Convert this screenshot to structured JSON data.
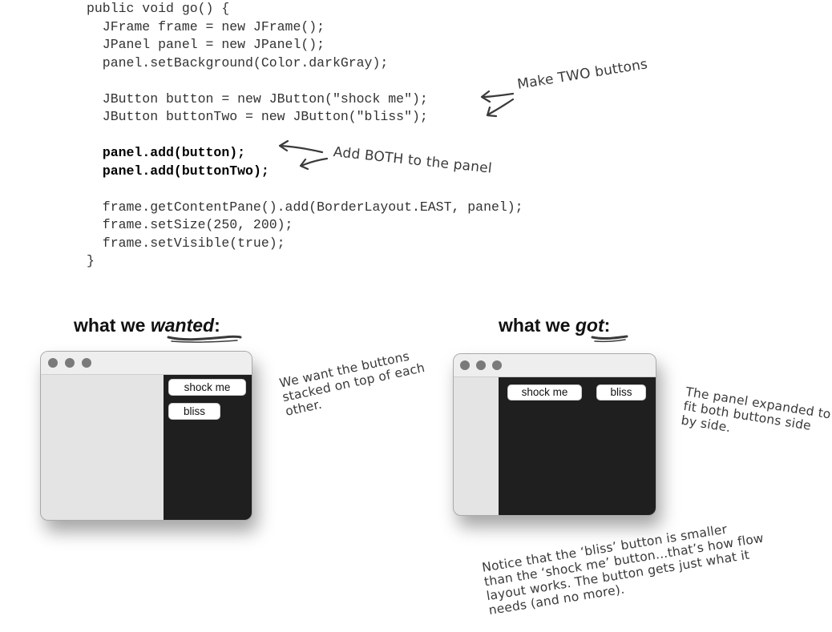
{
  "code": {
    "lines": [
      "public void go() {",
      "  JFrame frame = new JFrame();",
      "  JPanel panel = new JPanel();",
      "  panel.setBackground(Color.darkGray);",
      "",
      "  JButton button = new JButton(\"shock me\");",
      "  JButton buttonTwo = new JButton(\"bliss\");",
      "",
      "  ",
      "  ",
      "",
      "  frame.getContentPane().add(BorderLayout.EAST, panel);",
      "  frame.setSize(250, 200);",
      "  frame.setVisible(true);",
      "}"
    ],
    "bold_lines": [
      "panel.add(button);",
      "panel.add(buttonTwo);"
    ]
  },
  "annotations": {
    "two_buttons": "Make TWO buttons",
    "add_both": "Add BOTH to the panel",
    "wanted_note": [
      "We want the buttons",
      "stacked on top of each",
      "other."
    ],
    "got_note": [
      "The panel expanded to",
      "fit both buttons side",
      "by side."
    ],
    "flow_note": [
      "Notice that the ‘bliss’ button is smaller",
      "than the ‘shock me’ button...that’s how flow",
      "layout works. The button gets just what it",
      "needs (and no more)."
    ]
  },
  "headings": {
    "wanted_prefix": "what we ",
    "wanted_emph": "wanted",
    "got_prefix": "what we ",
    "got_emph": "got",
    "colon": ":"
  },
  "windows": {
    "wanted": {
      "button_one": "shock me",
      "button_two": "bliss"
    },
    "got": {
      "button_one": "shock me",
      "button_two": "bliss"
    }
  },
  "colors": {
    "panel": "#1f1f1f",
    "window": "#e4e4e4",
    "ink": "#3a3a3a"
  }
}
